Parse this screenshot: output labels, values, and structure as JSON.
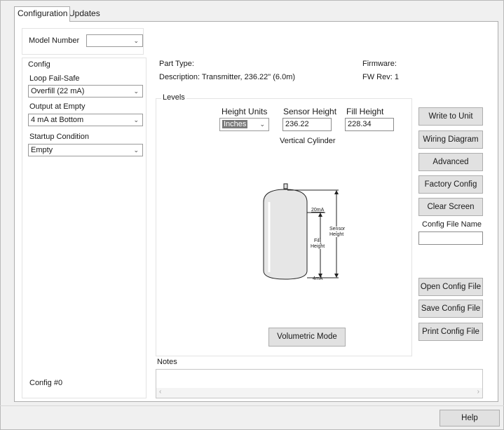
{
  "tabs": [
    "Configuration",
    "Updates"
  ],
  "model": {
    "label": "Model Number",
    "value": ""
  },
  "config": {
    "title": "Config",
    "loop_failsafe": {
      "label": "Loop Fail-Safe",
      "value": "Overfill (22 mA)"
    },
    "output_at_empty": {
      "label": "Output at Empty",
      "value": "4 mA at Bottom"
    },
    "startup_condition": {
      "label": "Startup Condition",
      "value": "Empty"
    },
    "config_number": "Config #0"
  },
  "info": {
    "part_type": "Part Type:",
    "description": "Description: Transmitter, 236.22\" (6.0m)",
    "firmware": "Firmware:",
    "fw_rev": "FW Rev: 1"
  },
  "levels": {
    "title": "Levels",
    "height_units": {
      "label": "Height Units",
      "value": "Inches"
    },
    "sensor_height": {
      "label": "Sensor Height",
      "value": "236.22"
    },
    "fill_height": {
      "label": "Fill Height",
      "value": "228.34"
    },
    "shape": "Vertical Cylinder",
    "diagram": {
      "top_label": "20mA",
      "bottom_label": "4mA",
      "fill_label_1": "Fill",
      "fill_label_2": "Height",
      "sensor_label_1": "Sensor",
      "sensor_label_2": "Height"
    },
    "volumetric_button": "Volumetric Mode"
  },
  "buttons": {
    "write": "Write to Unit",
    "wiring": "Wiring Diagram",
    "advanced": "Advanced",
    "factory": "Factory Config",
    "clear": "Clear Screen",
    "config_file_name_label": "Config File Name",
    "config_file_name_value": "",
    "open": "Open Config File",
    "save": "Save Config File",
    "print": "Print Config File"
  },
  "notes": {
    "label": "Notes",
    "value": ""
  },
  "help": "Help"
}
